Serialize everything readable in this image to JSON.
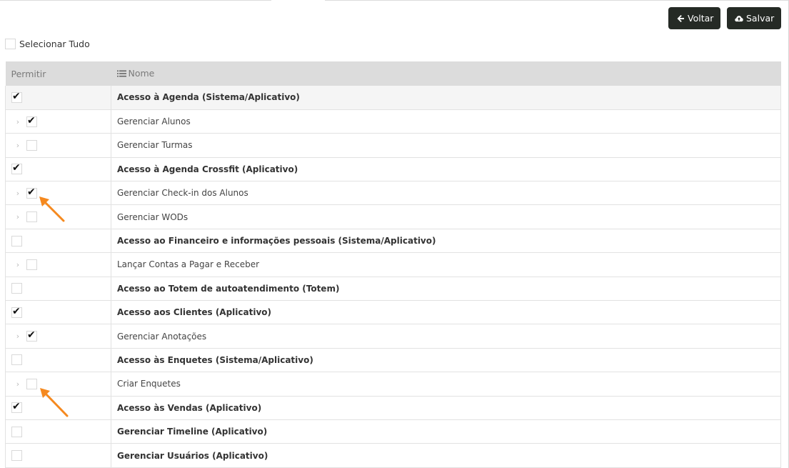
{
  "toolbar": {
    "back_label": "Voltar",
    "save_label": "Salvar"
  },
  "select_all": {
    "label": "Selecionar Tudo",
    "checked": false
  },
  "table": {
    "headers": {
      "allow": "Permitir",
      "name": "Nome"
    },
    "rows": [
      {
        "name": "Acesso à Agenda (Sistema/Aplicativo)",
        "parent": true,
        "checked": true
      },
      {
        "name": "Gerenciar Alunos",
        "parent": false,
        "checked": true
      },
      {
        "name": "Gerenciar Turmas",
        "parent": false,
        "checked": false
      },
      {
        "name": "Acesso à Agenda Crossfit (Aplicativo)",
        "parent": true,
        "checked": true
      },
      {
        "name": "Gerenciar Check-in dos Alunos",
        "parent": false,
        "checked": true
      },
      {
        "name": "Gerenciar WODs",
        "parent": false,
        "checked": false
      },
      {
        "name": "Acesso ao Financeiro e informações pessoais (Sistema/Aplicativo)",
        "parent": true,
        "checked": false
      },
      {
        "name": "Lançar Contas a Pagar e Receber",
        "parent": false,
        "checked": false
      },
      {
        "name": "Acesso ao Totem de autoatendimento (Totem)",
        "parent": true,
        "checked": false
      },
      {
        "name": "Acesso aos Clientes (Aplicativo)",
        "parent": true,
        "checked": true
      },
      {
        "name": "Gerenciar Anotações",
        "parent": false,
        "checked": true
      },
      {
        "name": "Acesso às Enquetes (Sistema/Aplicativo)",
        "parent": true,
        "checked": false
      },
      {
        "name": "Criar Enquetes",
        "parent": false,
        "checked": false
      },
      {
        "name": "Acesso às Vendas (Aplicativo)",
        "parent": true,
        "checked": true
      },
      {
        "name": "Gerenciar Timeline (Aplicativo)",
        "parent": true,
        "checked": false
      },
      {
        "name": "Gerenciar Usuários (Aplicativo)",
        "parent": true,
        "checked": false
      }
    ]
  },
  "colors": {
    "button_bg": "#252a25",
    "header_bg": "#dcdcdc",
    "annotation_arrow": "#f5891f"
  },
  "icons": {
    "back": "arrow-left-icon",
    "save": "cloud-upload-icon",
    "list": "list-icon",
    "expand": "chevron-right-icon"
  }
}
